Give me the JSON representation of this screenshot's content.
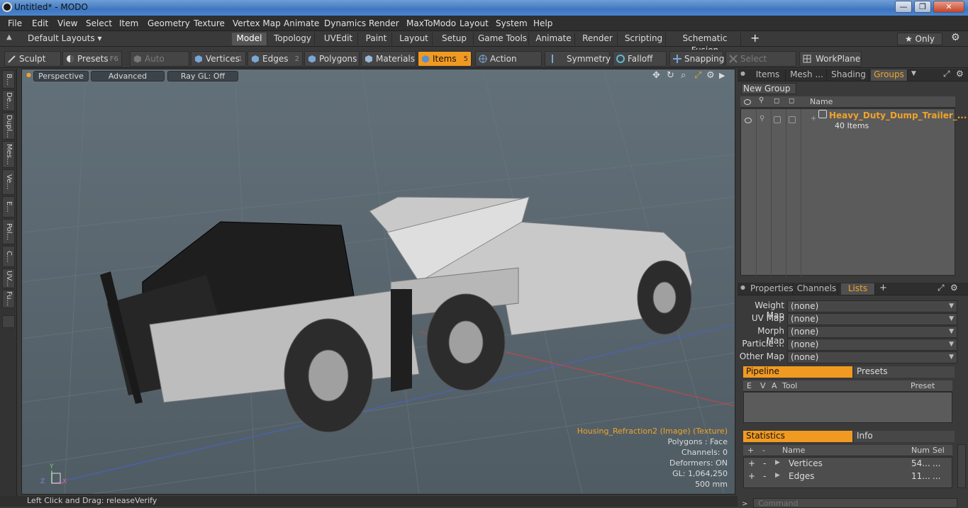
{
  "window": {
    "title": "Untitled* - MODO"
  },
  "menu": [
    "File",
    "Edit",
    "View",
    "Select",
    "Item",
    "Geometry",
    "Texture",
    "Vertex Map",
    "Animate",
    "Dynamics",
    "Render",
    "MaxToModo",
    "Layout",
    "System",
    "Help"
  ],
  "layout_bar": {
    "default_layouts": "Default Layouts ▾",
    "tabs": [
      "Model",
      "Topology",
      "UVEdit",
      "Paint",
      "Layout",
      "Setup",
      "Game Tools",
      "Animate",
      "Render",
      "Scripting",
      "Schematic Fusion"
    ],
    "active_tab": "Model",
    "add": "+",
    "only": "★  Only",
    "gear": "⚙"
  },
  "toolbar": {
    "sculpt": "Sculpt",
    "presets": "Presets",
    "presets_key": "F6",
    "auto_select": "Auto Select",
    "vertices": "Vertices",
    "vertices_num": "1",
    "edges": "Edges",
    "edges_num": "2",
    "polygons": "Polygons",
    "materials": "Materials",
    "items": "Items",
    "items_num": "5",
    "action_center": "Action Center",
    "symmetry": "Symmetry",
    "falloff": "Falloff",
    "snapping": "Snapping",
    "select_through": "Select Through",
    "workplane": "WorkPlane"
  },
  "left_strip": [
    "B...",
    "De...",
    "Dupl...",
    "Mes...",
    "Ve...",
    "E...",
    "Pol...",
    "C...",
    "UV...",
    "Fu..."
  ],
  "viewport": {
    "perspective": "Perspective",
    "advanced": "Advanced",
    "raygl": "Ray GL: Off",
    "info": {
      "texture": "Housing_Refraction2 (Image) (Texture)",
      "polygons": "Polygons : Face",
      "channels": "Channels: 0",
      "deformers": "Deformers: ON",
      "gl": "GL: 1,064,250",
      "scale": "500 mm"
    },
    "axis_y": "Y",
    "axis_z": "Z",
    "axis_x": "X"
  },
  "groups_panel": {
    "tabs": [
      "Items",
      "Mesh ...",
      "Shading",
      "Groups"
    ],
    "active": "Groups",
    "new_group": "New Group",
    "name_col": "Name",
    "group_name": "Heavy_Duty_Dump_Trailer_...",
    "group_count": "40 Items"
  },
  "lists_panel": {
    "tabs": [
      "Properties",
      "Channels",
      "Lists"
    ],
    "active": "Lists",
    "add": "+",
    "maps": [
      {
        "label": "Weight Map",
        "value": "(none)"
      },
      {
        "label": "UV Map",
        "value": "(none)"
      },
      {
        "label": "Morph Map",
        "value": "(none)"
      },
      {
        "label": "Particle ...",
        "value": "(none)"
      },
      {
        "label": "Other Map",
        "value": "(none)"
      }
    ],
    "pipeline": "Pipeline",
    "presets": "Presets",
    "pipeline_cols": [
      "E",
      "V",
      "A",
      "Tool",
      "Preset"
    ],
    "statistics": "Statistics",
    "info": "Info",
    "stats_cols": [
      "+",
      "-",
      "Name",
      "Num",
      "Sel"
    ],
    "stats_rows": [
      {
        "plus": "+",
        "minus": "-",
        "name": "Vertices",
        "num": "54...",
        "sel": "..."
      },
      {
        "plus": "+",
        "minus": "-",
        "name": "Edges",
        "num": "11...",
        "sel": "..."
      }
    ]
  },
  "command": {
    "placeholder": "Command"
  },
  "status": {
    "text": "Left Click and Drag:   releaseVerify"
  }
}
